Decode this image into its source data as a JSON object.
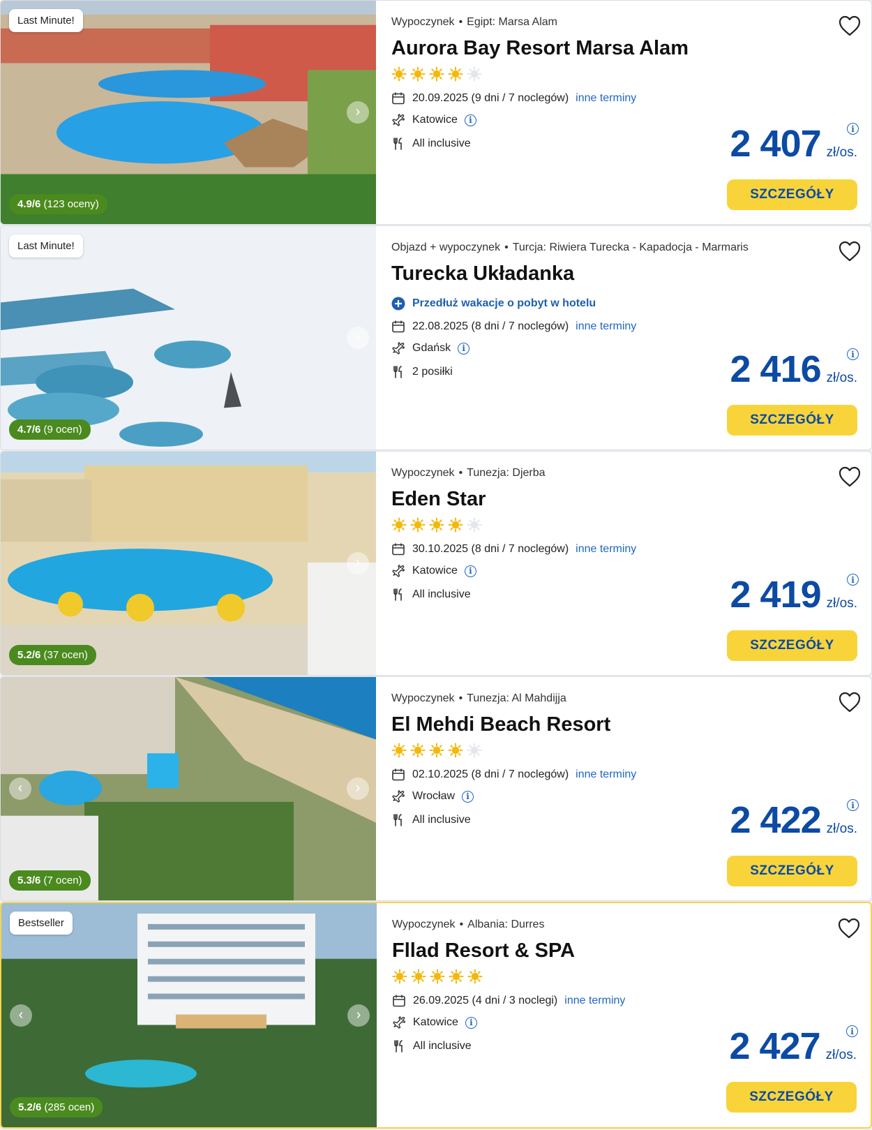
{
  "colors": {
    "accent": "#0c4aa3",
    "button": "#f8d43a",
    "rating_bg": "#4b8a1f",
    "star": "#f6b70b",
    "link": "#1f66c1"
  },
  "icons": {
    "favorite": "heart-icon",
    "date": "calendar-icon",
    "departure": "plane-icon",
    "board": "fork-knife-icon",
    "info": "info-icon",
    "extend": "plus-circle-icon"
  },
  "offers": [
    {
      "badge": "Last Minute!",
      "rating_score": "4.9/6",
      "rating_count": "(123 oceny)",
      "type": "Wypoczynek",
      "location": "Egipt: Marsa Alam",
      "name": "Aurora Bay Resort Marsa Alam",
      "stars": 4,
      "promo": "",
      "date": "20.09.2025 (9 dni / 7 noclegów)",
      "other_dates": "inne terminy",
      "departure": "Katowice",
      "board": "All inclusive",
      "price": "2 407",
      "price_unit": "zł/os.",
      "button": "SZCZEGÓŁY"
    },
    {
      "badge": "Last Minute!",
      "rating_score": "4.7/6",
      "rating_count": "(9 ocen)",
      "type": "Objazd + wypoczynek",
      "location": "Turcja: Riwiera Turecka - Kapadocja - Marmaris",
      "name": "Turecka Układanka",
      "stars": 0,
      "promo": "Przedłuż wakacje o pobyt w hotelu",
      "date": "22.08.2025 (8 dni / 7 noclegów)",
      "other_dates": "inne terminy",
      "departure": "Gdańsk",
      "board": "2 posiłki",
      "price": "2 416",
      "price_unit": "zł/os.",
      "button": "SZCZEGÓŁY"
    },
    {
      "badge": "",
      "rating_score": "5.2/6",
      "rating_count": "(37 ocen)",
      "type": "Wypoczynek",
      "location": "Tunezja: Djerba",
      "name": "Eden Star",
      "stars": 4,
      "promo": "",
      "date": "30.10.2025 (8 dni / 7 noclegów)",
      "other_dates": "inne terminy",
      "departure": "Katowice",
      "board": "All inclusive",
      "price": "2 419",
      "price_unit": "zł/os.",
      "button": "SZCZEGÓŁY"
    },
    {
      "badge": "",
      "rating_score": "5.3/6",
      "rating_count": "(7 ocen)",
      "type": "Wypoczynek",
      "location": "Tunezja: Al Mahdijja",
      "name": "El Mehdi Beach Resort",
      "stars": 4,
      "promo": "",
      "date": "02.10.2025 (8 dni / 7 noclegów)",
      "other_dates": "inne terminy",
      "departure": "Wrocław",
      "board": "All inclusive",
      "price": "2 422",
      "price_unit": "zł/os.",
      "button": "SZCZEGÓŁY"
    },
    {
      "badge": "Bestseller",
      "rating_score": "5.2/6",
      "rating_count": "(285 ocen)",
      "type": "Wypoczynek",
      "location": "Albania: Durres",
      "name": "Fllad Resort & SPA",
      "stars": 5,
      "promo": "",
      "date": "26.09.2025 (4 dni / 3 noclegi)",
      "other_dates": "inne terminy",
      "departure": "Katowice",
      "board": "All inclusive",
      "price": "2 427",
      "price_unit": "zł/os.",
      "button": "SZCZEGÓŁY"
    }
  ]
}
